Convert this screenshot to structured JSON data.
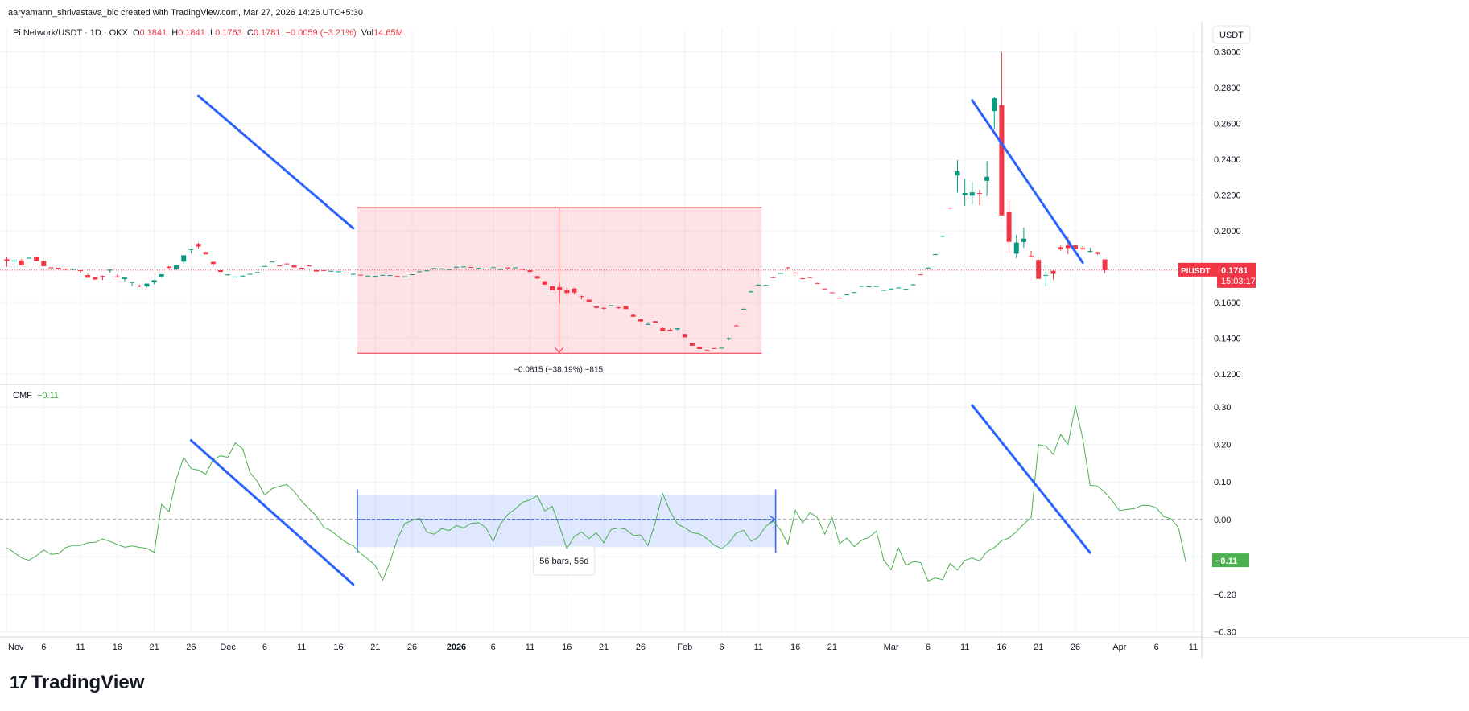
{
  "header": {
    "attribution": "aaryamann_shrivastava_bic created with TradingView.com, Mar 27, 2026 14:26 UTC+5:30",
    "symbol": "Pi Network/USDT · 1D · OKX",
    "o_label": "O",
    "o_value": "0.1841",
    "h_label": "H",
    "h_value": "0.1841",
    "l_label": "L",
    "l_value": "0.1763",
    "c_label": "C",
    "c_value": "0.1781",
    "change": "−0.0059 (−3.21%)",
    "vol_label": "Vol",
    "vol_value": "14.65M",
    "currency_button": "USDT"
  },
  "price_tag": {
    "symbol": "PIUSDT",
    "price": "0.1781",
    "countdown": "15:03:17"
  },
  "cmf_tag": {
    "value": "−0.11"
  },
  "indicator": {
    "name": "CMF",
    "value": "−0.11"
  },
  "measure_label": "−0.0815 (−38.19%) −815",
  "range_label": "56 bars, 56d",
  "brand": {
    "logo": "17",
    "name": "TradingView"
  },
  "colors": {
    "up": "#089981",
    "down": "#f23645",
    "trendline": "#2962ff",
    "cmf": "#4caf50"
  },
  "chart_data": [
    {
      "type": "candlestick",
      "series_name": "Pi Network/USDT",
      "x_ticks": [
        "Nov",
        "6",
        "11",
        "16",
        "21",
        "26",
        "Dec",
        "6",
        "11",
        "16",
        "21",
        "26",
        "2026",
        "6",
        "11",
        "16",
        "21",
        "26",
        "Feb",
        "6",
        "11",
        "16",
        "21",
        "Mar",
        "6",
        "11",
        "16",
        "21",
        "26",
        "Apr",
        "6",
        "11"
      ],
      "y_ticks": [
        "0.3000",
        "0.2800",
        "0.2600",
        "0.2400",
        "0.2200",
        "0.2000",
        "0.1800",
        "0.1600",
        "0.1400",
        "0.1200"
      ],
      "ylim": [
        0.116,
        0.3075
      ],
      "last_price": 0.1781,
      "start_date": "2025-11-01",
      "candles": [
        [
          0.1842,
          0.1852,
          0.18,
          0.1832
        ],
        [
          0.1832,
          0.1842,
          0.1824,
          0.1835
        ],
        [
          0.1835,
          0.1842,
          0.1826,
          0.1808
        ],
        [
          0.1848,
          0.1849,
          0.1844,
          0.185
        ],
        [
          0.1855,
          0.1857,
          0.1847,
          0.1831
        ],
        [
          0.1832,
          0.1835,
          0.1819,
          0.1803
        ],
        [
          0.1796,
          0.1793,
          0.1794,
          0.1791
        ],
        [
          0.1794,
          0.1792,
          0.1787,
          0.1785
        ],
        [
          0.1788,
          0.179,
          0.178,
          0.1785
        ],
        [
          0.1784,
          0.1788,
          0.178,
          0.1788
        ],
        [
          0.178,
          0.1784,
          0.1765,
          0.1778
        ],
        [
          0.1753,
          0.176,
          0.1744,
          0.1738
        ],
        [
          0.1743,
          0.1741,
          0.1734,
          0.1728
        ],
        [
          0.1748,
          0.1751,
          0.1726,
          0.1742
        ],
        [
          0.1778,
          0.1781,
          0.1767,
          0.1784
        ],
        [
          0.1746,
          0.1757,
          0.1738,
          0.174
        ],
        [
          0.1731,
          0.1738,
          0.1718,
          0.1739
        ],
        [
          0.171,
          0.1714,
          0.1692,
          0.1715
        ],
        [
          0.1695,
          0.1701,
          0.1686,
          0.1691
        ],
        [
          0.169,
          0.1695,
          0.1684,
          0.1706
        ],
        [
          0.1713,
          0.1718,
          0.1702,
          0.1725
        ],
        [
          0.1745,
          0.1742,
          0.1738,
          0.1758
        ],
        [
          0.18,
          0.1805,
          0.1788,
          0.1794
        ],
        [
          0.1784,
          0.1803,
          0.1784,
          0.1807
        ],
        [
          0.1829,
          0.1854,
          0.1816,
          0.1864
        ],
        [
          0.1894,
          0.1895,
          0.1876,
          0.19
        ],
        [
          0.1928,
          0.1935,
          0.1902,
          0.1913
        ],
        [
          0.1882,
          0.1884,
          0.1873,
          0.1869
        ],
        [
          0.1827,
          0.1829,
          0.1802,
          0.1815
        ],
        [
          0.178,
          0.1781,
          0.177,
          0.1771
        ],
        [
          0.1755,
          0.1756,
          0.175,
          0.1757
        ],
        [
          0.1742,
          0.1742,
          0.1739,
          0.1745
        ],
        [
          0.1749,
          0.1751,
          0.1749,
          0.175
        ],
        [
          0.1758,
          0.1759,
          0.1757,
          0.176
        ],
        [
          0.1766,
          0.1768,
          0.1765,
          0.177
        ],
        [
          0.1802,
          0.1803,
          0.18,
          0.1804
        ],
        [
          0.1826,
          0.1825,
          0.1824,
          0.1829
        ],
        [
          0.1807,
          0.1808,
          0.1803,
          0.1805
        ],
        [
          0.1818,
          0.1819,
          0.1812,
          0.1815
        ],
        [
          0.1808,
          0.1808,
          0.1799,
          0.1796
        ],
        [
          0.1794,
          0.1795,
          0.179,
          0.179
        ],
        [
          0.1807,
          0.1801,
          0.18,
          0.1802
        ],
        [
          0.1781,
          0.1779,
          0.1775,
          0.1773
        ],
        [
          0.1781,
          0.1781,
          0.1777,
          0.178
        ],
        [
          0.1776,
          0.1776,
          0.1775,
          0.1777
        ],
        [
          0.1771,
          0.1772,
          0.1771,
          0.1774
        ],
        [
          0.1767,
          0.1768,
          0.1767,
          0.1766
        ],
        [
          0.1758,
          0.1758,
          0.1755,
          0.176
        ],
        [
          0.1755,
          0.1756,
          0.1755,
          0.1754
        ],
        [
          0.175,
          0.1749,
          0.1748,
          0.175
        ],
        [
          0.1748,
          0.1749,
          0.1747,
          0.1748
        ],
        [
          0.1753,
          0.1754,
          0.1753,
          0.1754
        ],
        [
          0.1753,
          0.1753,
          0.1752,
          0.1753
        ],
        [
          0.1748,
          0.1747,
          0.1745,
          0.1745
        ],
        [
          0.1745,
          0.1745,
          0.1744,
          0.1746
        ],
        [
          0.1758,
          0.1758,
          0.1756,
          0.1758
        ],
        [
          0.1772,
          0.1773,
          0.1767,
          0.1774
        ],
        [
          0.1778,
          0.178,
          0.1776,
          0.1779
        ],
        [
          0.179,
          0.1791,
          0.1787,
          0.1792
        ],
        [
          0.1786,
          0.1788,
          0.1784,
          0.179
        ],
        [
          0.1786,
          0.1786,
          0.1786,
          0.1786
        ],
        [
          0.1798,
          0.18,
          0.1797,
          0.1799
        ],
        [
          0.18,
          0.1802,
          0.18,
          0.1801
        ],
        [
          0.1798,
          0.1798,
          0.1797,
          0.1797
        ],
        [
          0.1793,
          0.1794,
          0.1792,
          0.1793
        ],
        [
          0.1789,
          0.1789,
          0.1788,
          0.1789
        ],
        [
          0.1796,
          0.1796,
          0.1795,
          0.1797
        ],
        [
          0.1787,
          0.1788,
          0.1785,
          0.1787
        ],
        [
          0.1795,
          0.1798,
          0.1793,
          0.1794
        ],
        [
          0.1796,
          0.1796,
          0.1794,
          0.1796
        ],
        [
          0.1787,
          0.1787,
          0.1785,
          0.1783
        ],
        [
          0.178,
          0.1781,
          0.1773,
          0.1771
        ],
        [
          0.1747,
          0.1749,
          0.1732,
          0.1734
        ],
        [
          0.1719,
          0.1718,
          0.1704,
          0.17
        ],
        [
          0.1691,
          0.1691,
          0.1676,
          0.1668
        ],
        [
          0.1686,
          0.1715,
          0.1593,
          0.1672
        ],
        [
          0.1671,
          0.1682,
          0.1638,
          0.1653
        ],
        [
          0.1678,
          0.1684,
          0.1646,
          0.1656
        ],
        [
          0.1636,
          0.1639,
          0.1617,
          0.1633
        ],
        [
          0.1616,
          0.1617,
          0.1604,
          0.1601
        ],
        [
          0.1578,
          0.1578,
          0.1567,
          0.157
        ],
        [
          0.157,
          0.1574,
          0.1561,
          0.1569
        ],
        [
          0.1584,
          0.1585,
          0.1579,
          0.1585
        ],
        [
          0.1573,
          0.1576,
          0.1564,
          0.157
        ],
        [
          0.158,
          0.1582,
          0.1566,
          0.1563
        ],
        [
          0.1531,
          0.1538,
          0.152,
          0.1521
        ],
        [
          0.1506,
          0.151,
          0.1491,
          0.1495
        ],
        [
          0.1479,
          0.149,
          0.1478,
          0.148
        ],
        [
          0.1496,
          0.1497,
          0.1492,
          0.1487
        ],
        [
          0.1457,
          0.146,
          0.1446,
          0.144
        ],
        [
          0.1448,
          0.1455,
          0.1445,
          0.1439
        ],
        [
          0.145,
          0.1457,
          0.1444,
          0.1456
        ],
        [
          0.1424,
          0.1425,
          0.1407,
          0.1405
        ],
        [
          0.1373,
          0.1373,
          0.1358,
          0.1358
        ],
        [
          0.1351,
          0.1352,
          0.1348,
          0.134
        ],
        [
          0.1334,
          0.1337,
          0.1333,
          0.133
        ],
        [
          0.1345,
          0.1345,
          0.1342,
          0.1342
        ],
        [
          0.1344,
          0.1346,
          0.1342,
          0.1347
        ],
        [
          0.14,
          0.1404,
          0.1389,
          0.14
        ],
        [
          0.1472,
          0.1477,
          0.1472,
          0.1471
        ],
        [
          0.1565,
          0.1566,
          0.156,
          0.1565
        ],
        [
          0.1659,
          0.1665,
          0.1657,
          0.1662
        ],
        [
          0.1698,
          0.1702,
          0.1696,
          0.17
        ],
        [
          0.1697,
          0.17,
          0.1696,
          0.1698
        ],
        [
          0.1741,
          0.1743,
          0.174,
          0.174
        ],
        [
          0.1763,
          0.1764,
          0.1762,
          0.1765
        ],
        [
          0.1796,
          0.1799,
          0.1794,
          0.1795
        ],
        [
          0.1767,
          0.1768,
          0.1766,
          0.1766
        ],
        [
          0.1735,
          0.1737,
          0.1734,
          0.1734
        ],
        [
          0.1741,
          0.1744,
          0.174,
          0.174
        ],
        [
          0.1709,
          0.1711,
          0.1708,
          0.1706
        ],
        [
          0.1678,
          0.1679,
          0.1676,
          0.1676
        ],
        [
          0.1657,
          0.1656,
          0.1653,
          0.1653
        ],
        [
          0.1627,
          0.1629,
          0.1624,
          0.1622
        ],
        [
          0.1644,
          0.1646,
          0.1643,
          0.1645
        ],
        [
          0.1655,
          0.1658,
          0.1655,
          0.1658
        ],
        [
          0.169,
          0.1695,
          0.1689,
          0.1693
        ],
        [
          0.169,
          0.1691,
          0.1688,
          0.169
        ],
        [
          0.1691,
          0.169,
          0.1688,
          0.1692
        ],
        [
          0.167,
          0.1672,
          0.1668,
          0.167
        ],
        [
          0.1677,
          0.1679,
          0.1676,
          0.1678
        ],
        [
          0.1682,
          0.1684,
          0.1681,
          0.1684
        ],
        [
          0.1676,
          0.1677,
          0.1675,
          0.1676
        ],
        [
          0.1701,
          0.1704,
          0.17,
          0.1701
        ],
        [
          0.1757,
          0.1758,
          0.1755,
          0.1756
        ],
        [
          0.1795,
          0.1796,
          0.1793,
          0.1795
        ],
        [
          0.1869,
          0.1873,
          0.1866,
          0.187
        ],
        [
          0.197,
          0.1974,
          0.1964,
          0.1973
        ],
        [
          0.213,
          0.2131,
          0.2124,
          0.2128
        ],
        [
          0.231,
          0.2396,
          0.2215,
          0.2333
        ],
        [
          0.22,
          0.2291,
          0.2141,
          0.2212
        ],
        [
          0.2197,
          0.2274,
          0.2147,
          0.2216
        ],
        [
          0.2212,
          0.223,
          0.2143,
          0.221
        ],
        [
          0.228,
          0.239,
          0.2195,
          0.2303
        ],
        [
          0.267,
          0.2752,
          0.257,
          0.2742
        ],
        [
          0.2703,
          0.2998,
          0.2143,
          0.2087
        ],
        [
          0.2105,
          0.2172,
          0.1876,
          0.1939
        ],
        [
          0.1873,
          0.1979,
          0.1846,
          0.1935
        ],
        [
          0.1938,
          0.2019,
          0.1905,
          0.1957
        ],
        [
          0.186,
          0.1889,
          0.1854,
          0.1853
        ],
        [
          0.1838,
          0.1841,
          0.174,
          0.1732
        ],
        [
          0.1754,
          0.1811,
          0.1689,
          0.1754
        ],
        [
          0.1777,
          0.1779,
          0.1728,
          0.176
        ],
        [
          0.1909,
          0.1918,
          0.189,
          0.1897
        ],
        [
          0.1919,
          0.1966,
          0.1871,
          0.1905
        ],
        [
          0.1921,
          0.192,
          0.1901,
          0.1897
        ],
        [
          0.1904,
          0.1916,
          0.1894,
          0.1897
        ],
        [
          0.1888,
          0.1906,
          0.1879,
          0.1888
        ],
        [
          0.1882,
          0.1884,
          0.1866,
          0.1872
        ],
        [
          0.1841,
          0.1841,
          0.1763,
          0.1781
        ]
      ],
      "trendlines": [
        {
          "from": [
            "2025-11-27",
            0.2755
          ],
          "to": [
            "2025-12-18",
            0.2015
          ]
        },
        {
          "from": [
            "2026-03-12",
            0.273
          ],
          "to": [
            "2026-03-27",
            0.1823
          ]
        }
      ],
      "measure": {
        "from_date": "2025-12-19",
        "to_date": "2026-02-11",
        "top": 0.2131,
        "bottom": 0.1316
      }
    },
    {
      "type": "line",
      "series_name": "CMF",
      "y_ticks": [
        "0.30",
        "0.20",
        "0.10",
        "0.00",
        "−0.10",
        "−0.20",
        "−0.30"
      ],
      "ylim": [
        -0.305,
        0.345
      ],
      "zero_line": 0,
      "start_date": "2025-11-01",
      "values": [
        -0.0754,
        -0.0888,
        -0.1026,
        -0.109,
        -0.097,
        -0.0813,
        -0.093,
        -0.0913,
        -0.0748,
        -0.069,
        -0.0693,
        -0.0619,
        -0.0609,
        -0.0519,
        -0.0587,
        -0.0668,
        -0.0741,
        -0.0708,
        -0.0743,
        -0.0771,
        -0.088,
        0.0406,
        0.0209,
        0.1081,
        0.1652,
        0.1354,
        0.1316,
        0.1209,
        0.1602,
        0.1698,
        0.1658,
        0.2045,
        0.1881,
        0.1247,
        0.1013,
        0.0647,
        0.0823,
        0.0886,
        0.0929,
        0.0749,
        0.0485,
        0.0287,
        0.0093,
        -0.0209,
        -0.03,
        -0.0461,
        -0.0609,
        -0.0701,
        -0.0904,
        -0.1053,
        -0.123,
        -0.1622,
        -0.113,
        -0.0519,
        -0.0109,
        -0.0032,
        0.0038,
        -0.0339,
        -0.0395,
        -0.0243,
        -0.0298,
        -0.0163,
        -0.023,
        -0.0104,
        -0.0083,
        -0.0221,
        -0.0583,
        -0.0117,
        0.0134,
        0.0279,
        0.0458,
        0.0521,
        0.0626,
        0.0223,
        0.0347,
        -0.0182,
        -0.0783,
        -0.0455,
        -0.0335,
        -0.0513,
        -0.0353,
        -0.0622,
        -0.027,
        -0.0226,
        -0.0267,
        -0.0427,
        -0.0413,
        -0.0694,
        -0.0084,
        0.0687,
        0.0222,
        -0.0121,
        -0.0225,
        -0.035,
        -0.039,
        -0.0513,
        -0.0683,
        -0.078,
        -0.0619,
        -0.0364,
        -0.0292,
        -0.0582,
        -0.0472,
        -0.0177,
        -0.0048,
        -0.0286,
        -0.0658,
        0.0245,
        -0.0094,
        0.0186,
        0.0048,
        -0.0395,
        0.0046,
        -0.0646,
        -0.0497,
        -0.0722,
        -0.0553,
        -0.0479,
        -0.0309,
        -0.1078,
        -0.1352,
        -0.0761,
        -0.1224,
        -0.1123,
        -0.1148,
        -0.1638,
        -0.1564,
        -0.1608,
        -0.1174,
        -0.1353,
        -0.1092,
        -0.1028,
        -0.111,
        -0.0858,
        -0.075,
        -0.0566,
        -0.0498,
        -0.0326,
        -0.0125,
        0.0051,
        0.1991,
        0.1956,
        0.1736,
        0.2271,
        0.1997,
        0.3026,
        0.2163,
        0.0909,
        0.0891,
        0.0725,
        0.0497,
        0.0232,
        0.0267,
        0.0287,
        0.0373,
        0.0375,
        0.0305,
        0.0077,
        0.0014,
        -0.0223,
        -0.114
      ],
      "trendlines": [
        {
          "from": [
            "2025-11-26",
            0.2108
          ],
          "to": [
            "2025-12-18",
            -0.1733
          ]
        },
        {
          "from": [
            "2026-03-12",
            0.3045
          ],
          "to": [
            "2026-03-28",
            -0.0888
          ]
        }
      ],
      "range": {
        "from_date": "2025-12-19",
        "to_date": "2026-02-13",
        "top": 0.065,
        "bottom": -0.074
      }
    }
  ]
}
